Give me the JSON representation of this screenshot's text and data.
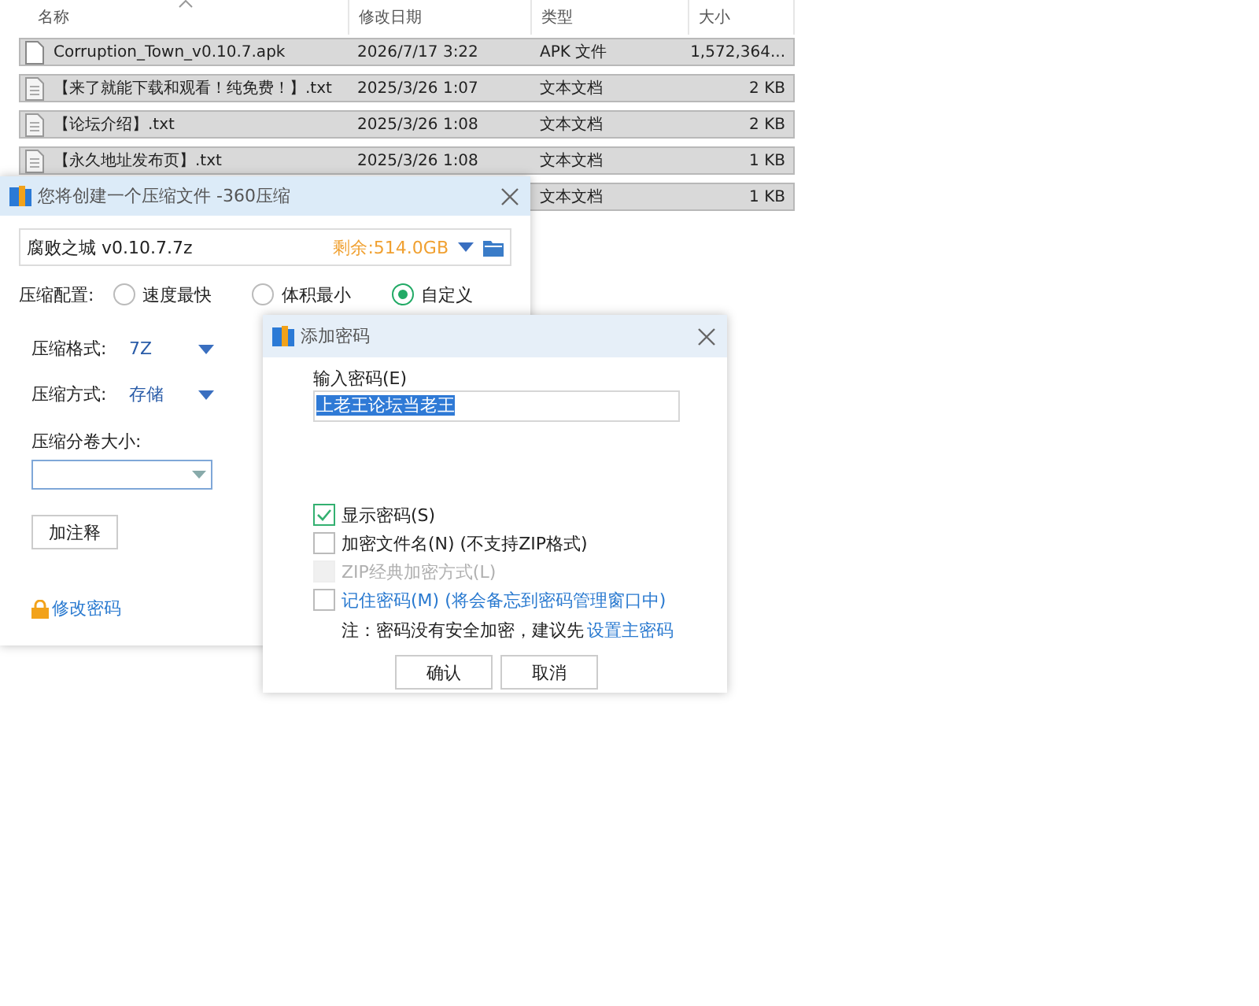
{
  "file_list": {
    "columns": [
      {
        "label": "名称",
        "sorted": true
      },
      {
        "label": "修改日期",
        "sorted": false
      },
      {
        "label": "类型",
        "sorted": false
      },
      {
        "label": "大小",
        "sorted": false
      }
    ],
    "rows": [
      {
        "name": "Corruption_Town_v0.10.7.apk",
        "date": "2026/7/17 3:22",
        "type": "APK 文件",
        "size": "1,572,364...",
        "kind": "apk",
        "selected": true
      },
      {
        "name": "【来了就能下载和观看！纯免费！】.txt",
        "date": "2025/3/26 1:07",
        "type": "文本文档",
        "size": "2 KB",
        "kind": "txt",
        "selected": true
      },
      {
        "name": "【论坛介绍】.txt",
        "date": "2025/3/26 1:08",
        "type": "文本文档",
        "size": "2 KB",
        "kind": "txt",
        "selected": true
      },
      {
        "name": "【永久地址发布页】.txt",
        "date": "2025/3/26 1:08",
        "type": "文本文档",
        "size": "1 KB",
        "kind": "txt",
        "selected": true
      },
      {
        "type": "文本文档",
        "size": "1 KB",
        "selected": true
      }
    ]
  },
  "compress_window": {
    "title": "您将创建一个压缩文件 -360压缩",
    "path": "腐败之城  v0.10.7.7z",
    "free_space": "剩余:514.0GB",
    "profile_label": "压缩配置:",
    "profiles": [
      {
        "label": "速度最快",
        "selected": false
      },
      {
        "label": "体积最小",
        "selected": false
      },
      {
        "label": "自定义",
        "selected": true
      }
    ],
    "format_label": "压缩格式:",
    "format": "7Z",
    "method_label": "压缩方式:",
    "method": "存储",
    "split_label": "压缩分卷大小:",
    "comment_button": "加注释",
    "password_link": "修改密码"
  },
  "password_dialog": {
    "title": "添加密码",
    "input_label": "输入密码(E)",
    "password": "上老王论坛当老王",
    "options": [
      {
        "label": "显示密码(S)",
        "checked": true,
        "disabled": false,
        "highlight": false
      },
      {
        "label": "加密文件名(N) (不支持ZIP格式)",
        "checked": false,
        "disabled": false,
        "highlight": false
      },
      {
        "label": "ZIP经典加密方式(L)",
        "checked": false,
        "disabled": true,
        "highlight": false
      },
      {
        "label": "记住密码(M) (将会备忘到密码管理窗口中)",
        "checked": false,
        "disabled": false,
        "highlight": true
      }
    ],
    "note": "注：密码没有安全加密，建议先",
    "note_link": "设置主密码",
    "buttons": [
      "确认",
      "取消"
    ]
  }
}
